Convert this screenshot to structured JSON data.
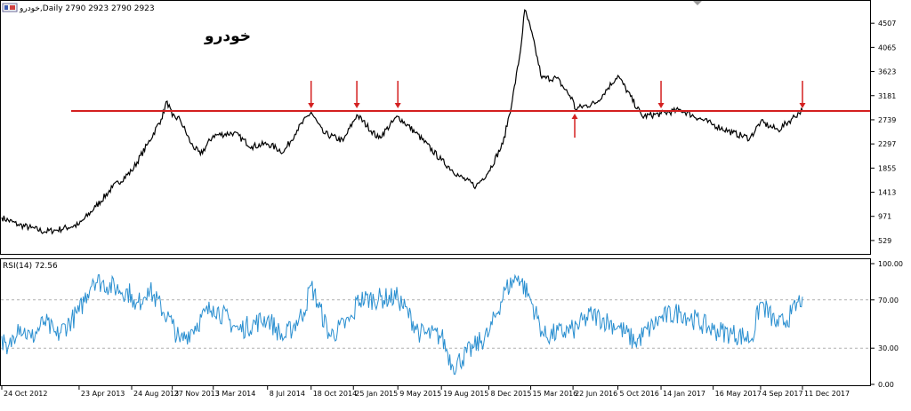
{
  "window": {
    "header_text": "خودرو,Daily  2790 2923 2790 2923",
    "symbol_watermark": "خودرو"
  },
  "colors": {
    "price_line": "#000000",
    "resistance_line": "#d42020",
    "arrows": "#d42020",
    "rsi_line": "#2a8fd0",
    "rsi_levels": "#b0b0b0",
    "frame": "#000000",
    "background": "#ffffff"
  },
  "chart_data": [
    {
      "type": "line",
      "name": "price",
      "price_axis_ticks": [
        4507,
        4065,
        3623,
        3181,
        2739,
        2297,
        1855,
        1413,
        971,
        529
      ],
      "ylim": [
        300,
        4900
      ],
      "resistance_level": 2900,
      "arrows_down_at": [
        "18 Oct 2014",
        "2 Feb 2015",
        "9 May 2015",
        "14 Jan 2017",
        "11 Dec 2017"
      ],
      "arrows_up_at": [
        "26 Jun 2016"
      ],
      "series": [
        {
          "points": [
            [
              "24 Oct 2012",
              950
            ],
            [
              "1 Dec 2012",
              820
            ],
            [
              "1 Jan 2013",
              760
            ],
            [
              "1 Feb 2013",
              690
            ],
            [
              "1 Mar 2013",
              720
            ],
            [
              "23 Apr 2013",
              820
            ],
            [
              "1 Jun 2013",
              1150
            ],
            [
              "10 Jul 2013",
              1500
            ],
            [
              "24 Aug 2013",
              1800
            ],
            [
              "1 Oct 2013",
              2300
            ],
            [
              "1 Nov 2013",
              2750
            ],
            [
              "15 Nov 2013",
              3080
            ],
            [
              "27 Nov 2013",
              2800
            ],
            [
              "15 Dec 2013",
              2750
            ],
            [
              "10 Jan 2014",
              2300
            ],
            [
              "1 Feb 2014",
              2100
            ],
            [
              "3 Mar 2014",
              2450
            ],
            [
              "20 Apr 2014",
              2500
            ],
            [
              "1 Jun 2014",
              2250
            ],
            [
              "8 Jul 2014",
              2300
            ],
            [
              "15 Aug 2014",
              2150
            ],
            [
              "15 Sep 2014",
              2550
            ],
            [
              "18 Oct 2014",
              2880
            ],
            [
              "15 Nov 2014",
              2500
            ],
            [
              "1 Jan 2015",
              2350
            ],
            [
              "2 Feb 2015",
              2830
            ],
            [
              "25 Mar 2015",
              2400
            ],
            [
              "9 May 2015",
              2800
            ],
            [
              "20 Jun 2015",
              2500
            ],
            [
              "19 Aug 2015",
              2000
            ],
            [
              "1 Oct 2015",
              1700
            ],
            [
              "8 Nov 2015",
              1520
            ],
            [
              "8 Dec 2015",
              1800
            ],
            [
              "10 Jan 2016",
              2300
            ],
            [
              "1 Feb 2016",
              3100
            ],
            [
              "20 Feb 2016",
              4000
            ],
            [
              "1 Mar 2016",
              4750
            ],
            [
              "15 Mar 2016",
              4400
            ],
            [
              "10 Apr 2016",
              3500
            ],
            [
              "15 May 2016",
              3500
            ],
            [
              "22 Jun 2016",
              3100
            ],
            [
              "26 Jun 2016",
              2940
            ],
            [
              "15 Aug 2016",
              3050
            ],
            [
              "5 Oct 2016",
              3550
            ],
            [
              "1 Dec 2016",
              2800
            ],
            [
              "14 Jan 2017",
              2850
            ],
            [
              "1 Mar 2017",
              2920
            ],
            [
              "16 May 2017",
              2650
            ],
            [
              "1 Jul 2017",
              2500
            ],
            [
              "10 Aug 2017",
              2400
            ],
            [
              "4 Sep 2017",
              2700
            ],
            [
              "15 Oct 2017",
              2550
            ],
            [
              "15 Nov 2017",
              2750
            ],
            [
              "11 Dec 2017",
              2923
            ]
          ]
        }
      ]
    },
    {
      "type": "line",
      "name": "rsi",
      "label": "RSI(14) 72.56",
      "axis_ticks": [
        "100.00",
        "70.00",
        "30.00",
        "0.00"
      ],
      "levels": [
        70,
        30
      ],
      "ylim": [
        0,
        100
      ],
      "series": [
        {
          "points": [
            [
              "24 Oct 2012",
              40
            ],
            [
              "5 Nov 2012",
              25
            ],
            [
              "1 Dec 2012",
              50
            ],
            [
              "1 Jan 2013",
              38
            ],
            [
              "1 Feb 2013",
              52
            ],
            [
              "1 Mar 2013",
              40
            ],
            [
              "23 Apr 2013",
              60
            ],
            [
              "25 May 2013",
              87
            ],
            [
              "24 Aug 2013",
              75
            ],
            [
              "1 Sep 2013",
              62
            ],
            [
              "1 Oct 2013",
              80
            ],
            [
              "27 Nov 2013",
              50
            ],
            [
              "15 Dec 2013",
              35
            ],
            [
              "3 Mar 2014",
              65
            ],
            [
              "1 May 2014",
              45
            ],
            [
              "8 Jul 2014",
              55
            ],
            [
              "15 Aug 2014",
              38
            ],
            [
              "1 Oct 2014",
              60
            ],
            [
              "18 Oct 2014",
              82
            ],
            [
              "1 Dec 2014",
              40
            ],
            [
              "25 Jan 2015",
              55
            ],
            [
              "2 Feb 2015",
              70
            ],
            [
              "9 May 2015",
              72
            ],
            [
              "1 Jul 2015",
              42
            ],
            [
              "19 Aug 2015",
              40
            ],
            [
              "15 Sep 2015",
              15
            ],
            [
              "1 Nov 2015",
              30
            ],
            [
              "8 Dec 2015",
              42
            ],
            [
              "15 Jan 2016",
              78
            ],
            [
              "15 Feb 2016",
              90
            ],
            [
              "15 Mar 2016",
              70
            ],
            [
              "15 Apr 2016",
              40
            ],
            [
              "22 Jun 2016",
              45
            ],
            [
              "5 Aug 2016",
              58
            ],
            [
              "5 Oct 2016",
              48
            ],
            [
              "15 Nov 2016",
              35
            ],
            [
              "14 Jan 2017",
              55
            ],
            [
              "1 Mar 2017",
              60
            ],
            [
              "16 May 2017",
              45
            ],
            [
              "1 Jul 2017",
              42
            ],
            [
              "15 Aug 2017",
              38
            ],
            [
              "4 Sep 2017",
              68
            ],
            [
              "15 Oct 2017",
              48
            ],
            [
              "15 Nov 2017",
              58
            ],
            [
              "11 Dec 2017",
              72.56
            ]
          ]
        }
      ]
    }
  ],
  "time_axis": {
    "labels": [
      "24 Oct 2012",
      "23 Apr 2013",
      "24 Aug 2013",
      "27 Nov 2013",
      "3 Mar 2014",
      "8 Jul 2014",
      "18 Oct 2014",
      "25 Jan 2015",
      "9 May 2015",
      "19 Aug 2015",
      "8 Dec 2015",
      "15 Mar 2016",
      "22 Jun 2016",
      "5 Oct 2016",
      "14 Jan 2017",
      "16 May 2017",
      "4 Sep 2017",
      "11 Dec 2017"
    ]
  }
}
